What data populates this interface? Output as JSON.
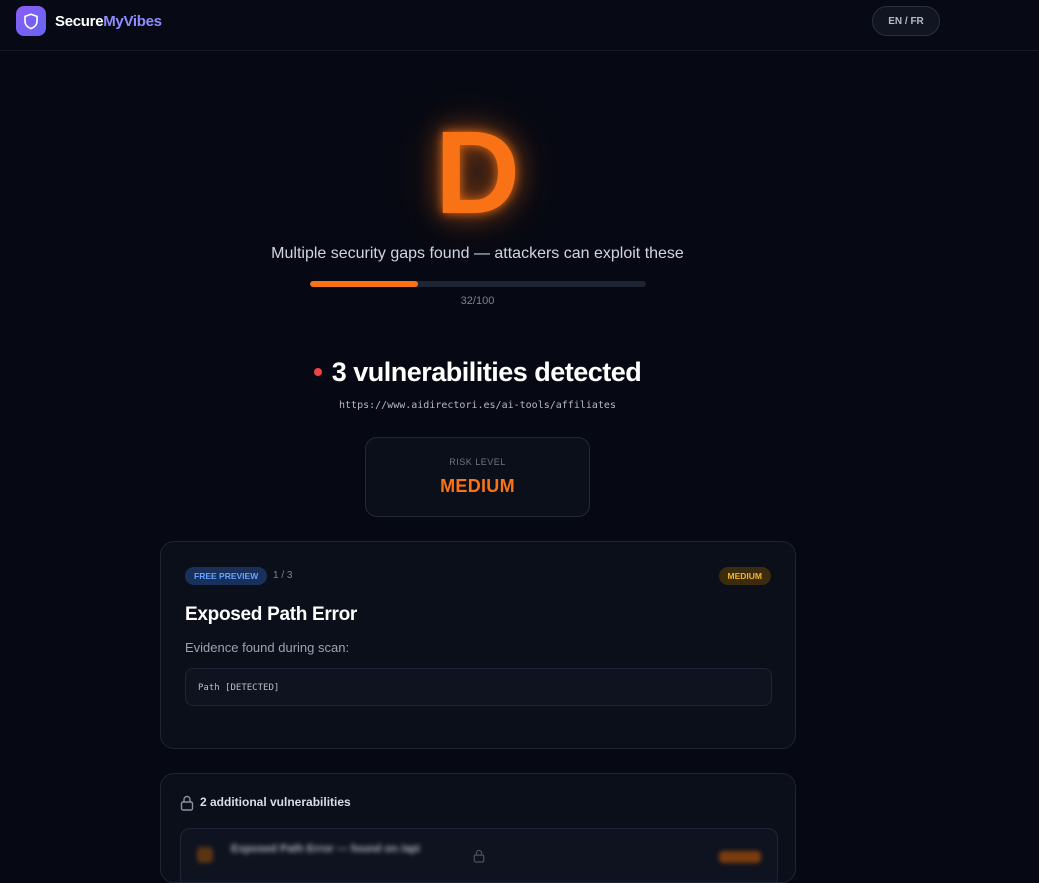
{
  "nav": {
    "brand_part1": "Secure",
    "brand_part2": "MyVibes",
    "lang_toggle": "EN / FR",
    "logo_icon": "shield-icon"
  },
  "result": {
    "grade": "D",
    "message": "Multiple security gaps found — attackers can exploit these",
    "score": 32,
    "score_max": 100,
    "score_text": "32/100",
    "grade_color": "#f97316"
  },
  "summary": {
    "title": "3 vulnerabilities detected",
    "url": "https://www.aidirectori.es/ai-tools/affiliates",
    "status_dot_color": "#ef4444"
  },
  "risk": {
    "label": "RISK LEVEL",
    "value": "MEDIUM"
  },
  "preview_card": {
    "badge": "FREE PREVIEW",
    "counter": "1 / 3",
    "severity": "MEDIUM",
    "title": "Exposed Path Error",
    "evidence_label": "Evidence found during scan:",
    "evidence_code": "Path [DETECTED]"
  },
  "locked_section": {
    "title": "2 additional vulnerabilities",
    "lock_icon": "lock-icon",
    "blurred_item_text": "Exposed Path Error — found on /api"
  },
  "colors": {
    "accent_orange": "#f97316",
    "accent_purple": "#8b5cf6",
    "background": "#060913",
    "badge_blue": "#66a3ff",
    "badge_yellow": "#f5b523"
  }
}
